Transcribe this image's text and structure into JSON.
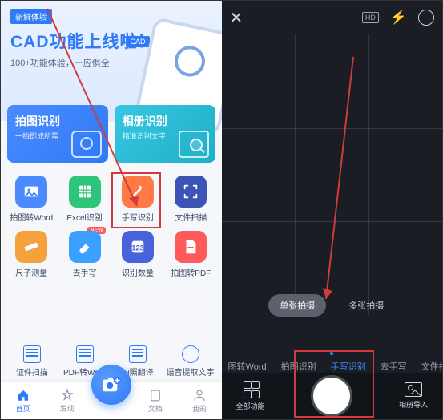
{
  "left": {
    "badge": "新鲜体验",
    "hero_title": "CAD功能上线啦！",
    "hero_sub": "100+功能体验，一应俱全",
    "chip": "CAD",
    "card1_title": "拍图识别",
    "card1_sub": "一拍即成所需",
    "card2_title": "相册识别",
    "card2_sub": "精准识别文字",
    "grid": {
      "r1": [
        {
          "label": "拍图转Word",
          "tile": "t-blue"
        },
        {
          "label": "Excel识别",
          "tile": "t-green"
        },
        {
          "label": "手写识别",
          "tile": "t-orange"
        },
        {
          "label": "文件扫描",
          "tile": "t-navy"
        }
      ],
      "r2": [
        {
          "label": "尺子测量",
          "tile": "t-gold"
        },
        {
          "label": "去手写",
          "tile": "t-sky",
          "new": "NEW"
        },
        {
          "label": "识别数量",
          "tile": "t-indigo"
        },
        {
          "label": "拍图转PDF",
          "tile": "t-red"
        }
      ]
    },
    "tabs": [
      "证件扫描",
      "PDF转Word",
      "拍照翻译",
      "语音提取文字"
    ],
    "nav": [
      "首页",
      "发现",
      "",
      "文档",
      "我的"
    ]
  },
  "right": {
    "hd": "HD",
    "mode_single": "单张拍摄",
    "mode_multi": "多张拍摄",
    "scroll": [
      "图转Word",
      "拍图识别",
      "手写识别",
      "去手写",
      "文件扫描"
    ],
    "all": "全部功能",
    "gallery": "相册导入"
  }
}
